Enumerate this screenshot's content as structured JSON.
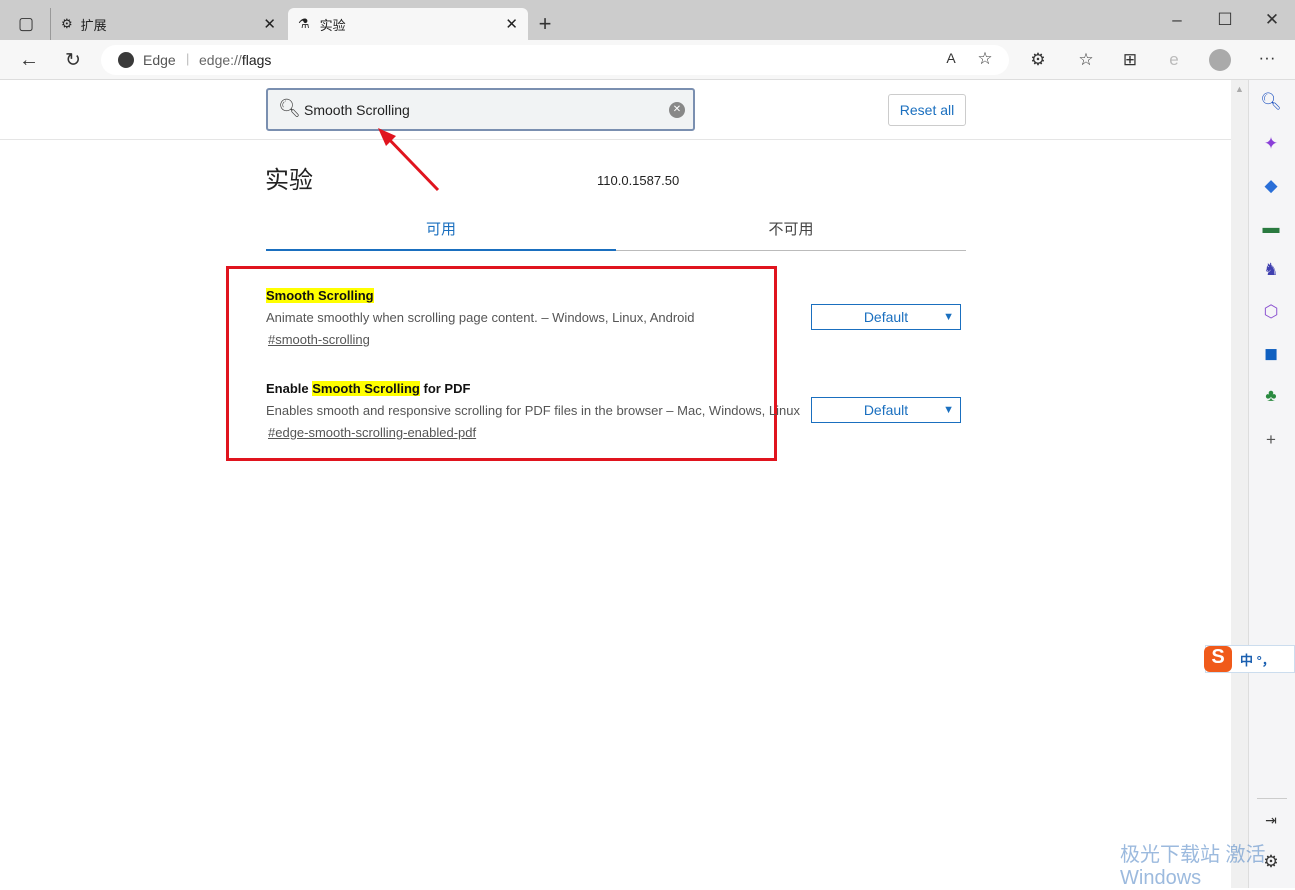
{
  "tabs": [
    {
      "label": "扩展",
      "icon": "puzzle-icon"
    },
    {
      "label": "实验",
      "icon": "flask-icon"
    }
  ],
  "address": {
    "site": "Edge",
    "url_prefix": "edge://",
    "url_host": "flags"
  },
  "search": {
    "value": "Smooth Scrolling"
  },
  "reset_label": "Reset all",
  "page_title": "实验",
  "version": "110.0.1587.50",
  "content_tabs": [
    {
      "label": "可用",
      "active": true
    },
    {
      "label": "不可用",
      "active": false
    }
  ],
  "flags": [
    {
      "title_pre": "",
      "title_hl": "Smooth Scrolling",
      "title_post": "",
      "desc": "Animate smoothly when scrolling page content. – Windows, Linux, Android",
      "link": "#smooth-scrolling",
      "value": "Default"
    },
    {
      "title_pre": "Enable ",
      "title_hl": "Smooth Scrolling",
      "title_post": " for PDF",
      "desc": "Enables smooth and responsive scrolling for PDF files in the browser – Mac, Windows, Linux",
      "link": "#edge-smooth-scrolling-enabled-pdf",
      "value": "Default"
    }
  ],
  "ime": {
    "label": "中 °，"
  },
  "watermark": "极光下载站 激活 Windows",
  "colors": {
    "accent": "#1a6fbf",
    "highlight": "#ffff00",
    "annotation": "#e0141e"
  }
}
